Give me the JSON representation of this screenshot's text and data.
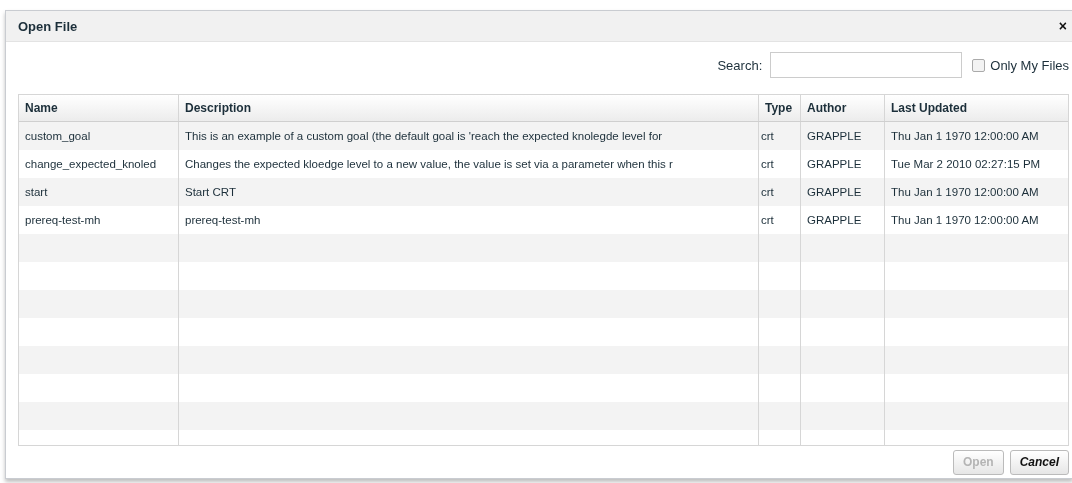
{
  "dialog": {
    "title": "Open File",
    "close": "×"
  },
  "search": {
    "label": "Search:"
  },
  "only_my_files": {
    "label": "Only My Files",
    "checked": false
  },
  "table": {
    "columns": [
      "Name",
      "Description",
      "Type",
      "Author",
      "Last Updated"
    ],
    "rows": [
      [
        "custom_goal",
        "This is an example of a custom goal (the default goal is 'reach the expected knolegde level for",
        "crt",
        "GRAPPLE",
        "Thu Jan 1 1970 12:00:00 AM"
      ],
      [
        "change_expected_knoled",
        "Changes the expected kloedge level to a new value, the value is set via a parameter when this r",
        "crt",
        "GRAPPLE",
        "Tue Mar 2 2010 02:27:15 PM"
      ],
      [
        "start",
        "Start CRT",
        "crt",
        "GRAPPLE",
        "Thu Jan 1 1970 12:00:00 AM"
      ],
      [
        "prereq-test-mh",
        "prereq-test-mh",
        "crt",
        "GRAPPLE",
        "Thu Jan 1 1970 12:00:00 AM"
      ]
    ]
  },
  "buttons": [
    {
      "label": "Open",
      "disabled": true
    },
    {
      "label": "Cancel",
      "disabled": false
    }
  ]
}
